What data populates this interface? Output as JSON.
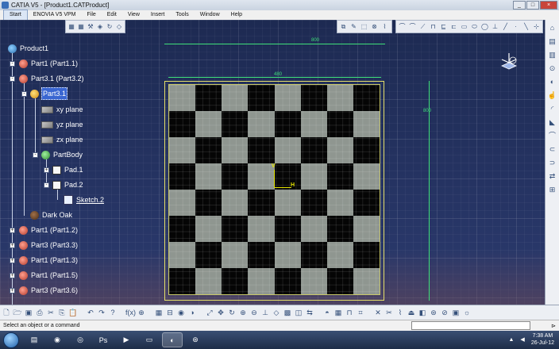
{
  "window": {
    "title": "CATIA V5 - [Product1.CATProduct]",
    "buttons": [
      "_",
      "□",
      "×"
    ]
  },
  "menubar": {
    "items": [
      "Start",
      "ENOVIA V5 VPM",
      "File",
      "Edit",
      "View",
      "Insert",
      "Tools",
      "Window",
      "Help"
    ]
  },
  "tree": {
    "rows": [
      {
        "label": "Product1",
        "icon": "product-icon"
      },
      {
        "label": "Part1 (Part1.1)",
        "icon": "part-icon"
      },
      {
        "label": "Part3.1 (Part3.2)",
        "icon": "part-icon"
      },
      {
        "label": "Part3.1",
        "icon": "part-icon"
      },
      {
        "label": "xy plane",
        "icon": "plane-icon"
      },
      {
        "label": "yz plane",
        "icon": "plane-icon"
      },
      {
        "label": "zx plane",
        "icon": "plane-icon"
      },
      {
        "label": "PartBody",
        "icon": "body-icon"
      },
      {
        "label": "Pad.1",
        "icon": "pad-icon"
      },
      {
        "label": "Pad.2",
        "icon": "pad-icon"
      },
      {
        "label": "Sketch.2",
        "icon": "sketch-icon"
      },
      {
        "label": "Dark Oak",
        "icon": "material-icon"
      },
      {
        "label": "Part1 (Part1.2)",
        "icon": "part-icon"
      },
      {
        "label": "Part3 (Part3.3)",
        "icon": "part-icon"
      },
      {
        "label": "Part1 (Part1.3)",
        "icon": "part-icon"
      },
      {
        "label": "Part1 (Part1.5)",
        "icon": "part-icon"
      },
      {
        "label": "Part3 (Part3.6)",
        "icon": "part-icon"
      }
    ]
  },
  "viewport": {
    "dimensions": {
      "top_outer": "800",
      "top_inner": "480",
      "right": "800"
    },
    "axis": {
      "h_label": "H",
      "v_label": "V"
    }
  },
  "statusbar": {
    "message": "Select an object or a command"
  },
  "taskbar": {
    "time": "7:38 AM",
    "date": "26-Jul-12"
  },
  "colors": {
    "background": "#233160",
    "selection": "#3a66d1",
    "sketch_lines": "#e6e06a",
    "dimensions": "#3fe07a"
  }
}
